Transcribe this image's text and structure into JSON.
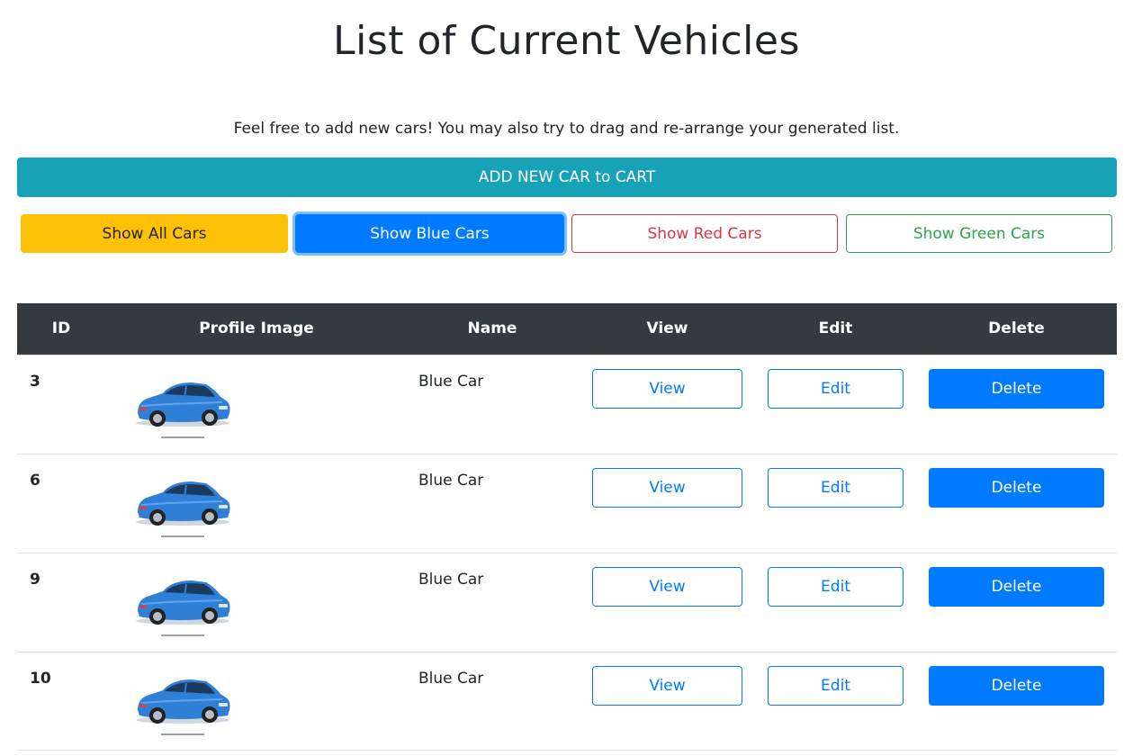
{
  "page": {
    "title": "List of Current Vehicles",
    "subtitle": "Feel free to add new cars! You may also try to drag and re-arrange your generated list."
  },
  "actions": {
    "add_label": "ADD NEW CAR to CART"
  },
  "filters": [
    {
      "label": "Show All Cars",
      "color": "#ffc107",
      "style": "solid"
    },
    {
      "label": "Show Blue Cars",
      "color": "#007bff",
      "style": "solid",
      "focused": true
    },
    {
      "label": "Show Red Cars",
      "color": "#dc3545",
      "style": "outline"
    },
    {
      "label": "Show Green Cars",
      "color": "#28a745",
      "style": "outline"
    }
  ],
  "table": {
    "headers": {
      "id": "ID",
      "image": "Profile Image",
      "name": "Name",
      "view": "View",
      "edit": "Edit",
      "delete": "Delete"
    },
    "rows": [
      {
        "id": "3",
        "image": "blue-car-image",
        "name": "Blue Car",
        "view": "View",
        "edit": "Edit",
        "delete": "Delete"
      },
      {
        "id": "6",
        "image": "blue-car-image",
        "name": "Blue Car",
        "view": "View",
        "edit": "Edit",
        "delete": "Delete"
      },
      {
        "id": "9",
        "image": "blue-car-image",
        "name": "Blue Car",
        "view": "View",
        "edit": "Edit",
        "delete": "Delete"
      },
      {
        "id": "10",
        "image": "blue-car-image",
        "name": "Blue Car",
        "view": "View",
        "edit": "Edit",
        "delete": "Delete"
      }
    ]
  },
  "colors": {
    "header_bg": "#343a40",
    "add_button": "#17a2b8",
    "primary": "#007bff"
  }
}
